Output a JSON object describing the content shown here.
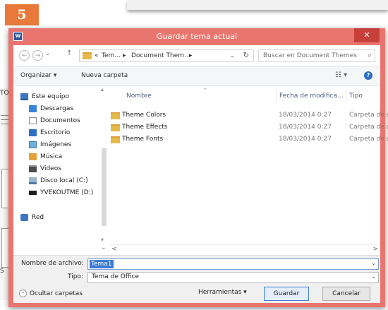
{
  "step_badge": "5",
  "background_fragment": "TO",
  "background_fragment_bottom": "S",
  "dialog": {
    "title": "Guardar tema actual",
    "close_glyph": "✕",
    "app_icon_letter": "W"
  },
  "address_bar": {
    "back_glyph": "←",
    "forward_glyph": "→",
    "up_glyph": "↑",
    "crumb_prefix": "«",
    "crumbs": [
      "Tem...",
      "Document Them..."
    ],
    "separator": "▸",
    "dropdown_glyph": "⌄",
    "refresh_glyph": "↻",
    "search_placeholder": "Buscar en Document Themes",
    "search_glyph": "⌕"
  },
  "toolbar": {
    "organize_label": "Organizar ▾",
    "new_folder_label": "Nueva carpeta",
    "view_glyph": "☷ ▾",
    "help_glyph": "?"
  },
  "nav_pane": {
    "items": [
      {
        "label": "Este equipo",
        "icon": "computer-icon"
      },
      {
        "label": "Descargas",
        "icon": "downloads-icon"
      },
      {
        "label": "Documentos",
        "icon": "documents-icon"
      },
      {
        "label": "Escritorio",
        "icon": "desktop-icon"
      },
      {
        "label": "Imágenes",
        "icon": "pictures-icon"
      },
      {
        "label": "Música",
        "icon": "music-icon"
      },
      {
        "label": "Videos",
        "icon": "videos-icon"
      },
      {
        "label": "Disco local (C:)",
        "icon": "local-disk-icon"
      },
      {
        "label": "YVEKOUTME (D:)",
        "icon": "usb-drive-icon"
      },
      {
        "label": "Red",
        "icon": "network-icon"
      }
    ],
    "scroll_up": "▴",
    "scroll_down": "▾"
  },
  "file_list": {
    "columns": {
      "name": "Nombre",
      "date": "Fecha de modifica...",
      "type": "Tipo"
    },
    "sort_glyph": "^",
    "rows": [
      {
        "name": "Theme Colors",
        "date": "18/03/2014 0:27",
        "type": "Carpeta de a"
      },
      {
        "name": "Theme Effects",
        "date": "18/03/2014 0:27",
        "type": "Carpeta de a"
      },
      {
        "name": "Theme Fonts",
        "date": "18/03/2014 0:27",
        "type": "Carpeta de a"
      }
    ],
    "hscroll_left": "<",
    "hscroll_right": ">",
    "vtoggle": "⌄"
  },
  "form": {
    "filename_label": "Nombre de archivo:",
    "filename_value": "Tema1",
    "filetype_label": "Tipo:",
    "filetype_value": "Tema de Office",
    "dropdown_glyph": "⌄"
  },
  "footer": {
    "hide_folders_label": "Ocultar carpetas",
    "hide_folders_glyph": "⌃",
    "tools_label": "Herramientas ▾",
    "save_label": "Guardar",
    "cancel_label": "Cancelar"
  }
}
